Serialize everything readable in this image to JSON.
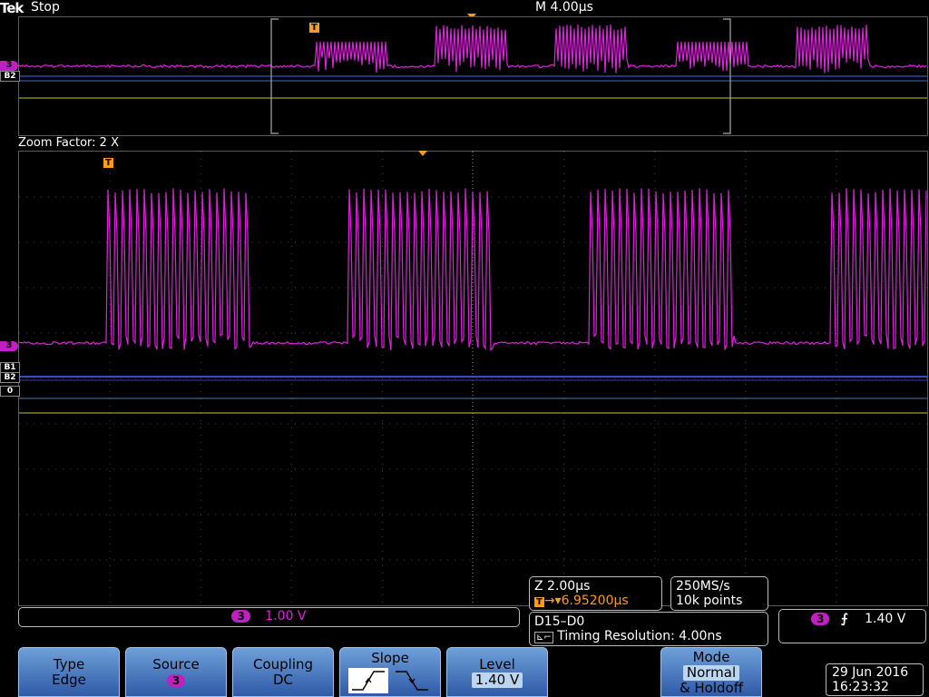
{
  "status": {
    "brand": "Tek",
    "acquisition_state": "Stop",
    "horizontal_scale": "M 4.00µs"
  },
  "zoom": {
    "label": "Zoom Factor: 2 X"
  },
  "markers": {
    "trigger_glyph": "T",
    "ch3_label": "3",
    "digital_labels": [
      "B2",
      "B1",
      "B2",
      "0"
    ]
  },
  "readouts": {
    "channel_scale": {
      "channel": "3",
      "value": "1.00 V"
    },
    "zoom_timebase": "Z 2.00µs",
    "trigger_position": "6.95200µs",
    "sample_rate": "250MS/s",
    "record_length": "10k points",
    "digital_group": "D15–D0",
    "timing_resolution": "Timing Resolution: 4.00ns",
    "trigger_info": {
      "channel": "3",
      "slope_icon": "rising-edge-icon",
      "level": "1.40 V"
    }
  },
  "menu": {
    "type": {
      "label": "Type",
      "value": "Edge"
    },
    "source": {
      "label": "Source",
      "value": "3"
    },
    "coupling": {
      "label": "Coupling",
      "value": "DC"
    },
    "slope": {
      "label": "Slope",
      "options": [
        "rising-slope-icon",
        "falling-slope-icon"
      ],
      "selected": "rising"
    },
    "level": {
      "label": "Level",
      "value": "1.40 V"
    },
    "mode": {
      "label": "Mode",
      "value": "Normal",
      "extra": "& Holdoff"
    }
  },
  "datetime": {
    "date": "29 Jun  2016",
    "time": "16:23:32"
  },
  "colors": {
    "ch3": "#e020e0",
    "trigger": "#ff9a1a",
    "digital_blue": "#3c6cff",
    "digital_yellow": "#c8c820",
    "menu_blue": "#4a7cc4"
  }
}
